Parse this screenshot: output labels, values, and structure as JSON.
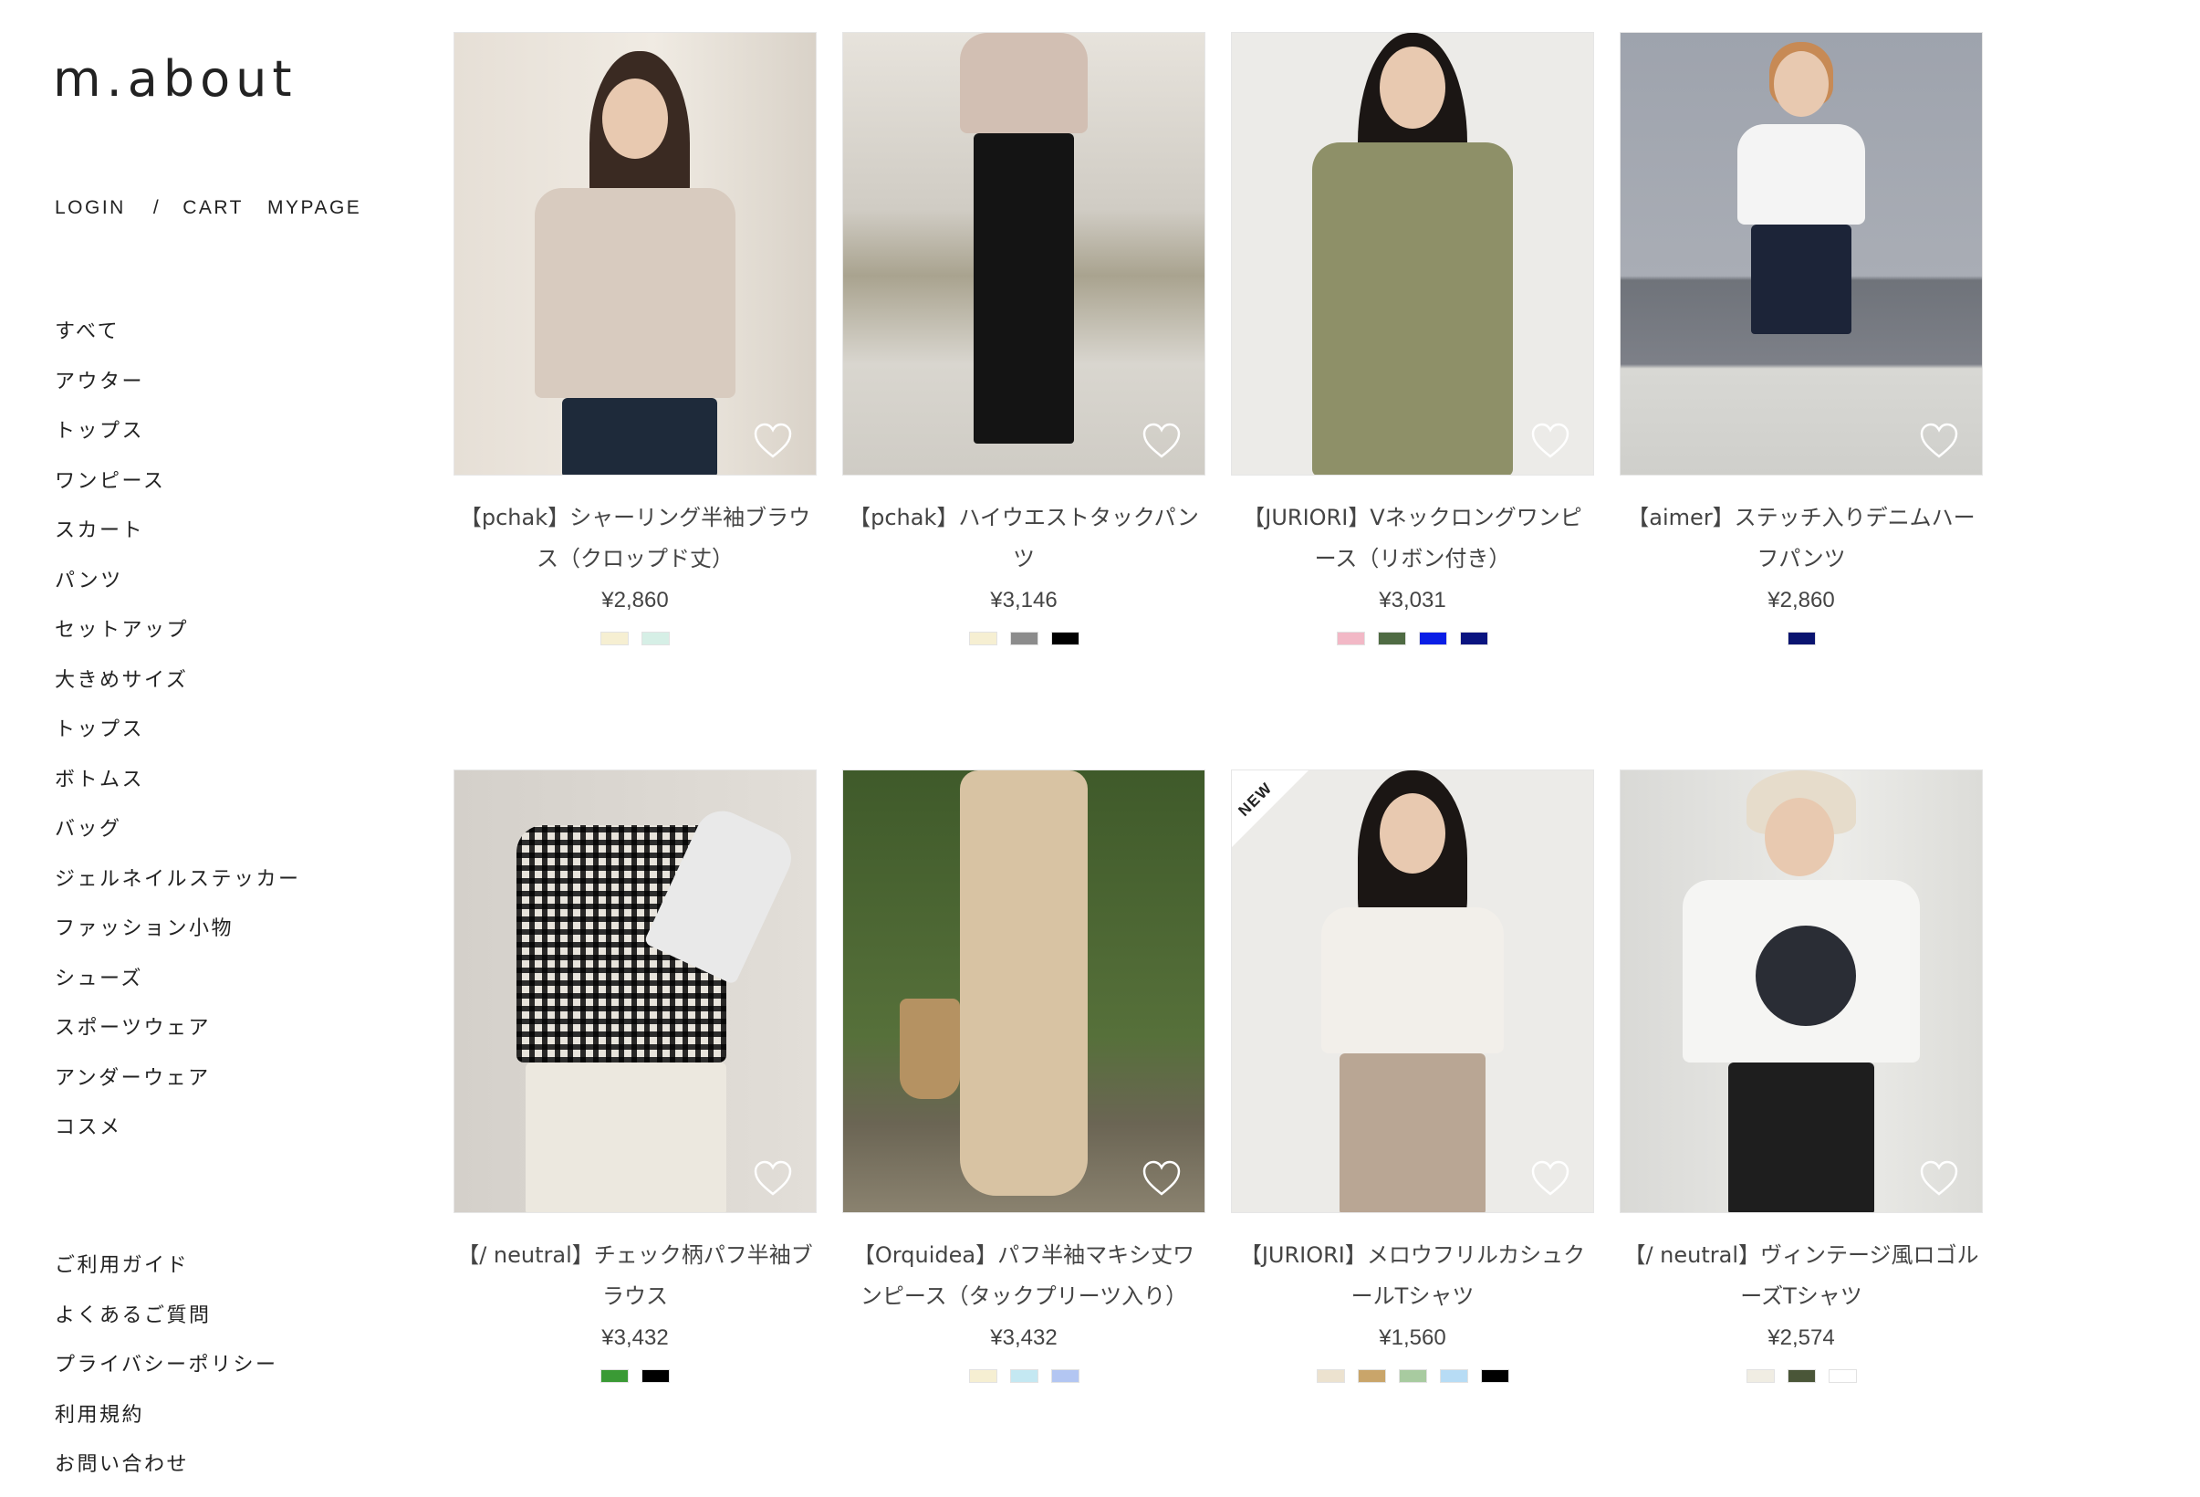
{
  "brand": {
    "logo_text": "m.about"
  },
  "utility_nav": {
    "login": "LOGIN",
    "separator": "/",
    "cart": "CART",
    "mypage": "MYPAGE"
  },
  "categories": [
    "すべて",
    "アウター",
    "トップス",
    "ワンピース",
    "スカート",
    "パンツ",
    "セットアップ",
    "大きめサイズ",
    "トップス",
    "ボトムス",
    "バッグ",
    "ジェルネイルステッカー",
    "ファッション小物",
    "シューズ",
    "スポーツウェア",
    "アンダーウェア",
    "コスメ"
  ],
  "info_links": [
    "ご利用ガイド",
    "よくあるご質問",
    "プライバシーポリシー",
    "利用規約",
    "お問い合わせ"
  ],
  "products": [
    {
      "name": "【pchak】シャーリング半袖ブラウス（クロップド丈）",
      "price": "¥2,860",
      "badge": "",
      "colors": [
        "#f6efd2",
        "#d6efe6"
      ],
      "icon": "heart-outline-icon"
    },
    {
      "name": "【pchak】ハイウエストタックパンツ",
      "price": "¥3,146",
      "badge": "",
      "colors": [
        "#f6efd2",
        "#8c8c8c",
        "#000000"
      ],
      "icon": "heart-outline-icon"
    },
    {
      "name": "【JURIORI】Vネックロングワンピース（リボン付き）",
      "price": "¥3,031",
      "badge": "",
      "colors": [
        "#f2b8c6",
        "#4f6b43",
        "#0a1ee6",
        "#0a1480"
      ],
      "icon": "heart-outline-icon"
    },
    {
      "name": "【aimer】ステッチ入りデニムハーフパンツ",
      "price": "¥2,860",
      "badge": "",
      "colors": [
        "#0a1470"
      ],
      "icon": "heart-outline-icon"
    },
    {
      "name": "【/ neutral】チェック柄パフ半袖ブラウス",
      "price": "¥3,432",
      "badge": "",
      "colors": [
        "#3a9a35",
        "#000000"
      ],
      "icon": "heart-outline-icon"
    },
    {
      "name": "【Orquidea】パフ半袖マキシ丈ワンピース（タックプリーツ入り）",
      "price": "¥3,432",
      "badge": "",
      "colors": [
        "#f6efd2",
        "#c4e8f2",
        "#b3c6f2"
      ],
      "icon": "heart-outline-icon"
    },
    {
      "name": "【JURIORI】メロウフリルカシュクールTシャツ",
      "price": "¥1,560",
      "badge": "NEW",
      "colors": [
        "#ece2cf",
        "#c9a56a",
        "#a8cba0",
        "#b7dcf5",
        "#000000"
      ],
      "icon": "heart-outline-icon"
    },
    {
      "name": "【/ neutral】ヴィンテージ風ロゴルーズTシャツ",
      "price": "¥2,574",
      "badge": "",
      "colors": [
        "#f0ede3",
        "#4a5638",
        "#ffffff"
      ],
      "icon": "heart-outline-icon"
    }
  ]
}
